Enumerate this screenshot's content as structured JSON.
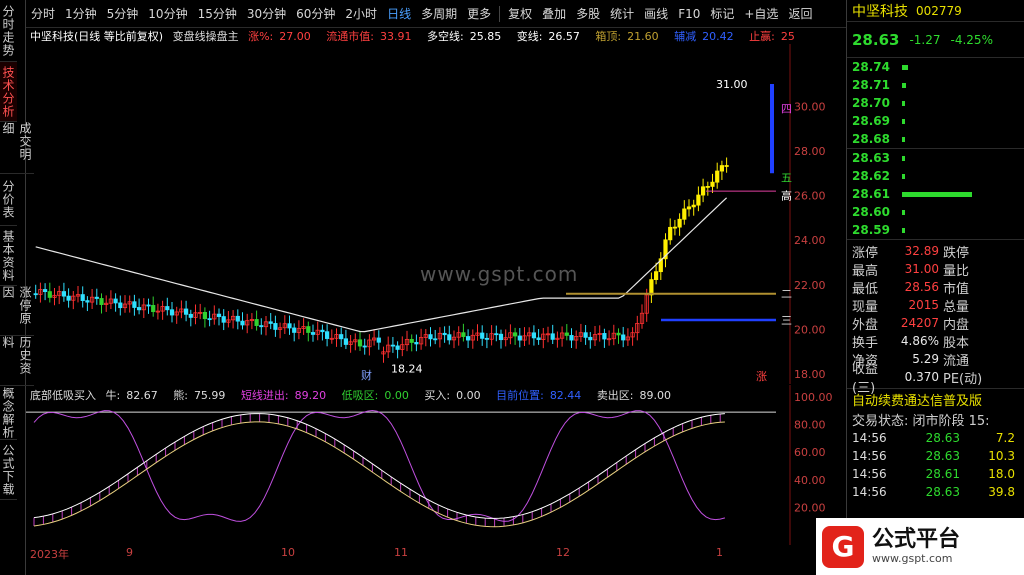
{
  "left_tabs": [
    "分时走势",
    "技术分析",
    "成交明细",
    "分价表",
    "基本资料",
    "涨停原因",
    "历史资料",
    "概念解析",
    "公式下载"
  ],
  "toolbar": {
    "periods": [
      "分时",
      "1分钟",
      "5分钟",
      "10分钟",
      "15分钟",
      "30分钟",
      "60分钟",
      "2小时",
      "日线",
      "多周期",
      "更多"
    ],
    "actions": [
      "复权",
      "叠加",
      "多股",
      "统计",
      "画线",
      "F10",
      "标记",
      "+自选",
      "返回"
    ]
  },
  "info": {
    "stock": "中坚科技(日线 等比前复权)",
    "formula": "变盘线操盘主",
    "zhang_label": "涨%:",
    "zhang": "27.00",
    "mv_label": "流通市值:",
    "mv": "33.91",
    "dk_label": "多空线:",
    "dk": "25.85",
    "bx_label": "变线:",
    "bx": "26.57",
    "xd_label": "箱顶:",
    "xd": "21.60",
    "ws_label": "辅减",
    "ws": "20.42",
    "zy_label": "止赢:",
    "zy": "25"
  },
  "indicator": {
    "name": "底部低吸买入",
    "niu_label": "牛:",
    "niu": "82.67",
    "xiong_label": "熊:",
    "xiong": "75.99",
    "dx_label": "短线进出:",
    "dx": "89.20",
    "dxq_label": "低吸区:",
    "dxq": "0.00",
    "buy_label": "买入:",
    "buy": "0.00",
    "rs_label": "目前位置:",
    "rs": "82.44",
    "sell_label": "卖出区:",
    "sell": "89.00"
  },
  "chart_labels": {
    "high": "31.00",
    "low": "18.24",
    "si": "四",
    "wu": "五",
    "gao": "高",
    "er": "二",
    "san": "三",
    "cai": "财",
    "zhang": "涨",
    "watermark": "www.gspt.com"
  },
  "main_axis": [
    "30.00",
    "28.00",
    "26.00",
    "24.00",
    "22.00",
    "20.00",
    "18.00"
  ],
  "ind_axis": [
    "100.00",
    "80.00",
    "60.00",
    "40.00",
    "20.00"
  ],
  "dates": [
    "2023年",
    "9",
    "10",
    "11",
    "12",
    "1"
  ],
  "panel": {
    "name": "中坚科技",
    "code": "002779",
    "price": "28.63",
    "chg": "-1.27",
    "pct": "-4.25%",
    "asks": [
      {
        "p": "28.74",
        "w": 6
      },
      {
        "p": "28.71",
        "w": 4
      },
      {
        "p": "28.70",
        "w": 3
      },
      {
        "p": "28.69",
        "w": 3
      },
      {
        "p": "28.68",
        "w": 3
      }
    ],
    "bids": [
      {
        "p": "28.63",
        "w": 3
      },
      {
        "p": "28.62",
        "w": 3
      },
      {
        "p": "28.61",
        "w": 70
      },
      {
        "p": "28.60",
        "w": 3
      },
      {
        "p": "28.59",
        "w": 3
      }
    ],
    "stats": [
      {
        "k": "涨停",
        "v": "32.89",
        "vc": "#ff4040",
        "k2": "跌停"
      },
      {
        "k": "最高",
        "v": "31.00",
        "vc": "#ff4040",
        "k2": "量比"
      },
      {
        "k": "最低",
        "v": "28.56",
        "vc": "#ff4040",
        "k2": "市值"
      },
      {
        "k": "现量",
        "v": "2015",
        "vc": "#ff4040",
        "k2": "总量"
      },
      {
        "k": "外盘",
        "v": "24207",
        "vc": "#ff4040",
        "k2": "内盘"
      },
      {
        "k": "换手",
        "v": "4.86%",
        "vc": "#e8e8e8",
        "k2": "股本"
      },
      {
        "k": "净资",
        "v": "5.29",
        "vc": "#e8e8e8",
        "k2": "流通"
      },
      {
        "k": "收益(三)",
        "v": "0.370",
        "vc": "#e8e8e8",
        "k2": "PE(动)"
      }
    ],
    "ad": "自动续费通达信普及版",
    "status": "交易状态: 闭市阶段 15:",
    "ticks": [
      {
        "t": "14:56",
        "p": "28.63",
        "q": "7.2"
      },
      {
        "t": "14:56",
        "p": "28.63",
        "q": "10.3"
      },
      {
        "t": "14:56",
        "p": "28.61",
        "q": "18.0"
      },
      {
        "t": "14:56",
        "p": "28.63",
        "q": "39.8"
      }
    ]
  },
  "logo": {
    "name": "公式平台",
    "url": "www.gspt.com"
  }
}
